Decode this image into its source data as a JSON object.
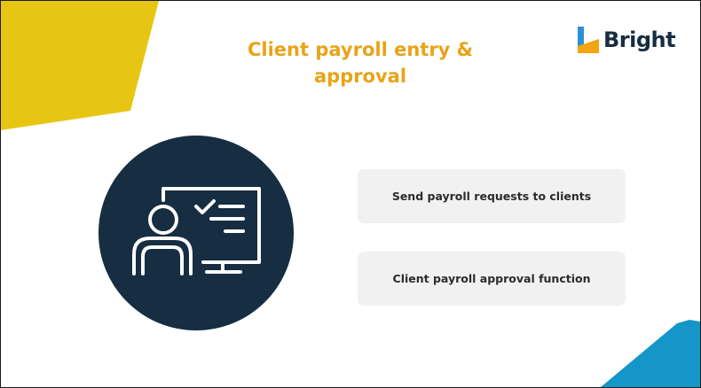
{
  "slide": {
    "title": "Client payroll entry & approval",
    "logo": {
      "text": "Bright",
      "mark_icon": "bright-logo-mark-icon",
      "colors": {
        "mark_blue": "#2b8fd6",
        "mark_orange": "#f2a413",
        "text": "#162d42"
      }
    },
    "feature_icon": "user-computer-checklist-icon",
    "features": [
      {
        "label": "Send payroll requests to clients"
      },
      {
        "label": "Client payroll approval function"
      }
    ],
    "colors": {
      "title": "#e8a317",
      "circle": "#162d42",
      "card_background": "#f1f1f1",
      "yellow_accent": "#e7c613",
      "blue_accent": "#1496c9"
    }
  }
}
